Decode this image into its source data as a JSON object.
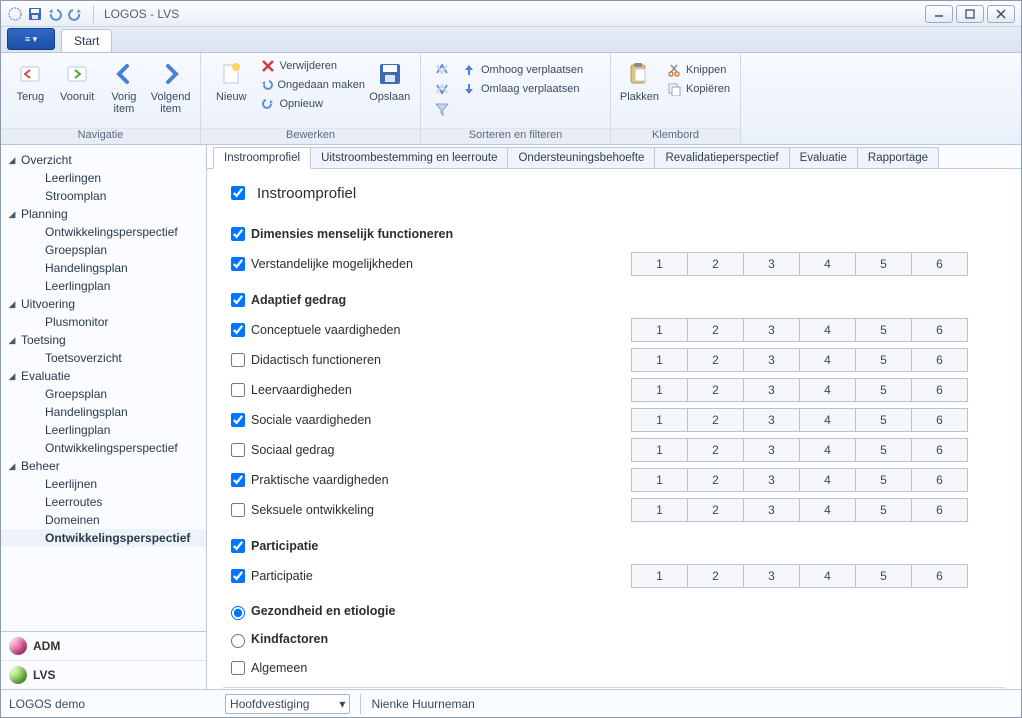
{
  "title": "LOGOS - LVS",
  "ribbon": {
    "tab_start": "Start",
    "groups": {
      "navigatie": {
        "label": "Navigatie",
        "terug": "Terug",
        "vooruit": "Vooruit",
        "vorig": "Vorig\nitem",
        "volgend": "Volgend\nitem"
      },
      "bewerken": {
        "label": "Bewerken",
        "nieuw": "Nieuw",
        "verwijderen": "Verwijderen",
        "ongedaan": "Ongedaan maken",
        "opnieuw": "Opnieuw",
        "opslaan": "Opslaan"
      },
      "sorteren": {
        "label": "Sorteren en filteren",
        "omhoog": "Omhoog verplaatsen",
        "omlaag": "Omlaag verplaatsen"
      },
      "klembord": {
        "label": "Klembord",
        "plakken": "Plakken",
        "knippen": "Knippen",
        "kopieren": "Kopiëren"
      }
    }
  },
  "sidebar": {
    "groups": [
      {
        "label": "Overzicht",
        "items": [
          "Leerlingen",
          "Stroomplan"
        ]
      },
      {
        "label": "Planning",
        "items": [
          "Ontwikkelingsperspectief",
          "Groepsplan",
          "Handelingsplan",
          "Leerlingplan"
        ]
      },
      {
        "label": "Uitvoering",
        "items": [
          "Plusmonitor"
        ]
      },
      {
        "label": "Toetsing",
        "items": [
          "Toetsoverzicht"
        ]
      },
      {
        "label": "Evaluatie",
        "items": [
          "Groepsplan",
          "Handelingsplan",
          "Leerlingplan",
          "Ontwikkelingsperspectief"
        ]
      },
      {
        "label": "Beheer",
        "items": [
          "Leerlijnen",
          "Leerroutes",
          "Domeinen",
          "Ontwikkelingsperspectief"
        ]
      }
    ],
    "modules": {
      "adm": "ADM",
      "lvs": "LVS"
    }
  },
  "tabs": [
    "Instroomprofiel",
    "Uitstroombestemming en leerroute",
    "Ondersteuningsbehoefte",
    "Revalidatieperspectief",
    "Evaluatie",
    "Rapportage"
  ],
  "panel": {
    "title": "Instroomprofiel",
    "scale": [
      "1",
      "2",
      "3",
      "4",
      "5",
      "6"
    ],
    "sections": [
      {
        "heading": "Dimensies menselijk functioneren",
        "checked": true
      },
      {
        "label": "Verstandelijke mogelijkheden",
        "checked": true,
        "scale": true
      }
    ],
    "adaptief": {
      "heading": "Adaptief gedrag",
      "rows": [
        {
          "label": "Conceptuele vaardigheden",
          "checked": true
        },
        {
          "label": "Didactisch functioneren",
          "checked": false
        },
        {
          "label": "Leervaardigheden",
          "checked": false
        },
        {
          "label": "Sociale vaardigheden",
          "checked": true
        },
        {
          "label": "Sociaal gedrag",
          "checked": false
        },
        {
          "label": "Praktische vaardigheden",
          "checked": true
        },
        {
          "label": "Seksuele ontwikkeling",
          "checked": false
        }
      ]
    },
    "participatie": {
      "heading": "Participatie",
      "rows": [
        {
          "label": "Participatie",
          "checked": true
        }
      ]
    },
    "radios": {
      "gezondheid": "Gezondheid en etiologie",
      "kindfactoren": "Kindfactoren"
    },
    "algemeen": {
      "label": "Algemeen",
      "checked": false
    }
  },
  "statusbar": {
    "app": "LOGOS demo",
    "location": "Hoofdvestiging",
    "user": "Nienke Huurneman"
  }
}
